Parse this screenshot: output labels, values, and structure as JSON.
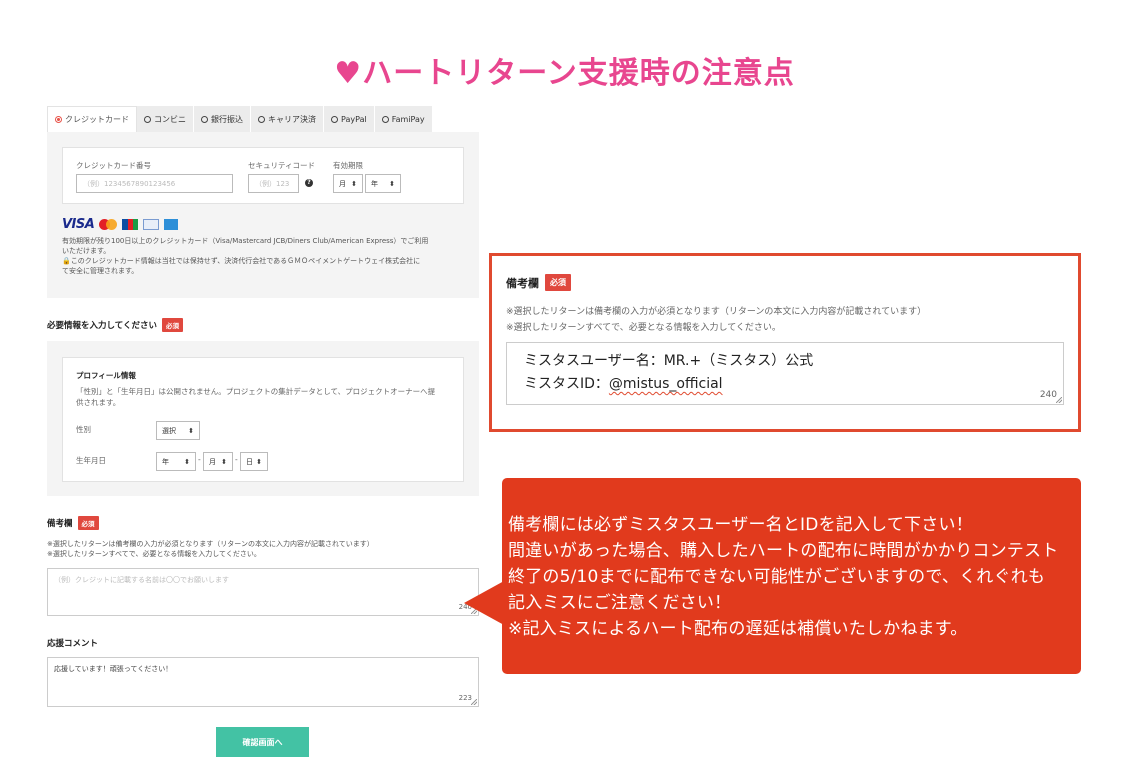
{
  "page_title": "♥ハートリターン支援時の注意点",
  "payment": {
    "tabs": [
      {
        "label": "クレジットカード",
        "selected": true
      },
      {
        "label": "コンビニ",
        "selected": false
      },
      {
        "label": "銀行振込",
        "selected": false
      },
      {
        "label": "キャリア決済",
        "selected": false
      },
      {
        "label": "PayPal",
        "selected": false
      },
      {
        "label": "FamiPay",
        "selected": false
      }
    ],
    "card_number_label": "クレジットカード番号",
    "card_number_placeholder": "（例）1234567890123456",
    "security_code_label": "セキュリティコード",
    "security_code_placeholder": "（例）123",
    "expiry_label": "有効期限",
    "month_select": "月",
    "year_select": "年",
    "card_brands": [
      "VISA",
      "MasterCard",
      "JCB",
      "Diners Club",
      "American Express"
    ],
    "note_1_line_1": "有効期限が残り100日以上のクレジットカード（Visa/Mastercard JCB/Diners Club/American Express）でご利用",
    "note_1_line_2": "いただけます。",
    "note_2_line_1": "🔒このクレジットカード情報は当社では保持せず、決済代行会社であるＧＭＯペイメントゲートウェイ株式会社に",
    "note_2_line_2": "て安全に管理されます。"
  },
  "required_info": {
    "title": "必要情報を入力してください",
    "required_badge": "必須"
  },
  "profile": {
    "title": "プロフィール情報",
    "note_line_1": "「性別」と「生年月日」は公開されません。プロジェクトの集計データとして、プロジェクトオーナーへ提",
    "note_line_2": "供されます。",
    "gender_label": "性別",
    "gender_select": "選択",
    "birth_label": "生年月日",
    "birth_year": "年",
    "birth_month": "月",
    "birth_day": "日",
    "separator": "-"
  },
  "remarks": {
    "title": "備考欄",
    "required_badge": "必須",
    "note_line_1": "※選択したリターンは備考欄の入力が必須となります（リターンの本文に入力内容が記載されています）",
    "note_line_2": "※選択したリターンすべてで、必要となる情報を入力してください。",
    "placeholder": "（例）クレジットに記載する名前は〇〇でお願いします",
    "counter": "240"
  },
  "support_comment": {
    "title": "応援コメント",
    "value": "応援しています！頑張ってください！",
    "counter": "223"
  },
  "confirm_button": "確認画面へ",
  "zoomed_remarks": {
    "title": "備考欄",
    "required_badge": "必須",
    "note_line_1": "※選択したリターンは備考欄の入力が必須となります（リターンの本文に入力内容が記載されています）",
    "note_line_2": "※選択したリターンすべてで、必要となる情報を入力してください。",
    "line_1": "ミスタスユーザー名：MR.+（ミスタス）公式",
    "line_2_prefix": "ミスタスID：",
    "line_2_id": "@mistus_official",
    "counter": "240"
  },
  "callout": {
    "lines": [
      "備考欄には必ずミスタスユーザー名とIDを記入して下さい！",
      "間違いがあった場合、購入したハートの配布に時間がかかりコンテスト",
      "終了の5/10までに配布できない可能性がございますので、くれぐれも",
      "記入ミスにご注意ください！",
      "※記入ミスによるハート配布の遅延は補償いたしかねます。"
    ]
  },
  "colors": {
    "title_pink": "#e8468f",
    "required_red": "#e0483e",
    "callout_red": "#e13a1d",
    "confirm_green": "#43c2a4"
  }
}
